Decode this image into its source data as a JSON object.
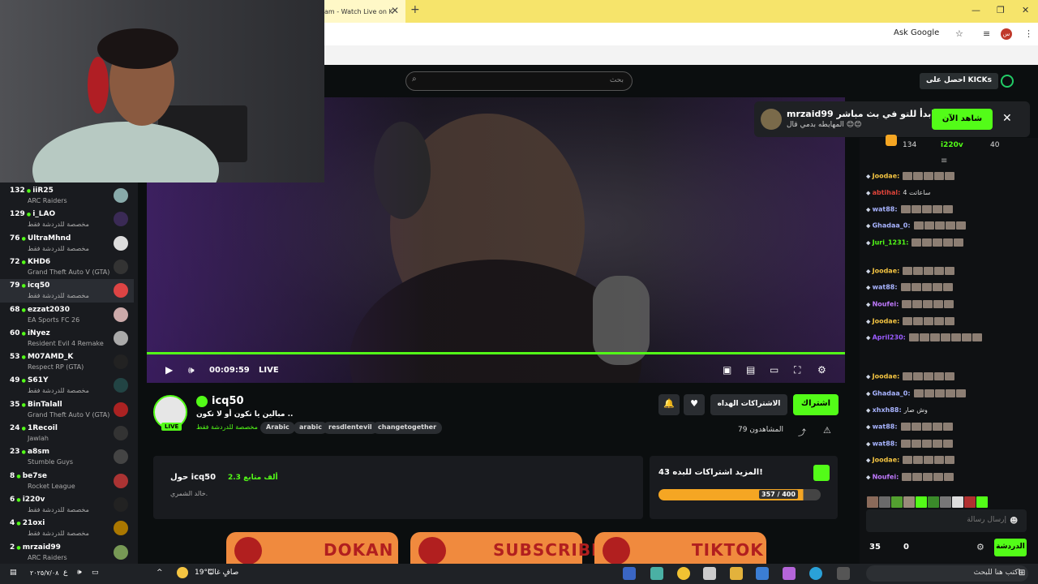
{
  "browser": {
    "tab_title": "am - Watch Live on K",
    "ask_google": "Ask Google",
    "profile_initial": "س"
  },
  "nav": {
    "search_placeholder": "بحث",
    "get_kicks": "احصل على KICKs"
  },
  "notification": {
    "title": "mrzaid99 ابدأ للتو في بث مباشر!",
    "subtitle": "المهايطه بدمي قال 😊😊",
    "watch_now": "شاهد الآن"
  },
  "sidebar": {
    "channels": [
      {
        "count": "132",
        "name": "iiR25",
        "game": "ARC Raiders"
      },
      {
        "count": "129",
        "name": "i_LAO",
        "game": "مخصصة للدردشة فقط"
      },
      {
        "count": "76",
        "name": "UltraMhnd",
        "game": "مخصصة للدردشة فقط"
      },
      {
        "count": "72",
        "name": "KHD6",
        "game": "Grand Theft Auto V (GTA)"
      },
      {
        "count": "79",
        "name": "icq50",
        "game": "مخصصة للدردشة فقط"
      },
      {
        "count": "68",
        "name": "ezzat2030",
        "game": "EA Sports FC 26"
      },
      {
        "count": "60",
        "name": "iNyez",
        "game": "Resident Evil 4 Remake"
      },
      {
        "count": "53",
        "name": "M07AMD_K",
        "game": "Respect RP (GTA)"
      },
      {
        "count": "49",
        "name": "S61Y",
        "game": "مخصصة للدردشة فقط"
      },
      {
        "count": "35",
        "name": "BinTalall",
        "game": "Grand Theft Auto V (GTA)"
      },
      {
        "count": "24",
        "name": "1Recoil",
        "game": "Jawlah"
      },
      {
        "count": "23",
        "name": "a8sm",
        "game": "Stumble Guys"
      },
      {
        "count": "8",
        "name": "be7se",
        "game": "Rocket League"
      },
      {
        "count": "6",
        "name": "i220v",
        "game": "مخصصة للدردشة فقط"
      },
      {
        "count": "4",
        "name": "21oxi",
        "game": "مخصصة للدردشة فقط"
      },
      {
        "count": "2",
        "name": "mrzaid99",
        "game": "ARC Raiders"
      }
    ]
  },
  "player": {
    "time": "00:09:59",
    "live": "LIVE"
  },
  "streamer": {
    "name": "icq50",
    "live_badge": "LIVE",
    "title": "مبالين يا نكون أو لا نكون ..",
    "category": "مخصصة للدردشة فقط",
    "tags": [
      "Arabic",
      "arabic",
      "resdlentevil",
      "changetogether"
    ],
    "follow": "اشتراك",
    "subscriptions": "الاشتراكات الهداه",
    "viewers": "المشاهدون 79"
  },
  "about": {
    "title": "حول icq50",
    "followers": "2.3 ألف متابع",
    "desc": "خالد الشمري."
  },
  "sub_goal": {
    "title": "المزيد اشتراكات للبده 43!",
    "progress_text": "357 / 400",
    "progress": 0.8925
  },
  "banners": [
    "DOKAN",
    "SUBSCRIBE",
    "TIKTOK"
  ],
  "chat": {
    "top_stats": {
      "left": "134",
      "mid": "i220v",
      "right": "40"
    },
    "messages": [
      {
        "name": "Joodae:",
        "color": "#f5c542",
        "text": ""
      },
      {
        "name": "abtihal:",
        "color": "#e0443a",
        "text": "ساعاتت 4"
      },
      {
        "name": "wat88:",
        "color": "#a8b4ff",
        "text": ""
      },
      {
        "name": "Ghadaa_0:",
        "color": "#a8b4ff",
        "text": ""
      },
      {
        "name": "Juri_1231:",
        "color": "#53fc18",
        "text": ""
      },
      {
        "name": "Joodae:",
        "color": "#f5c542",
        "text": ""
      },
      {
        "name": "wat88:",
        "color": "#a8b4ff",
        "text": ""
      },
      {
        "name": "Noufei:",
        "color": "#c17aff",
        "text": ""
      },
      {
        "name": "Joodae:",
        "color": "#f5c542",
        "text": ""
      },
      {
        "name": "April230:",
        "color": "#9b5cff",
        "text": ""
      },
      {
        "name": "Joodae:",
        "color": "#f5c542",
        "text": ""
      },
      {
        "name": "Ghadaa_0:",
        "color": "#a8b4ff",
        "text": ""
      },
      {
        "name": "xhxh88:",
        "color": "#a8b4ff",
        "text": "وش صار"
      },
      {
        "name": "wat88:",
        "color": "#a8b4ff",
        "text": ""
      },
      {
        "name": "wat88:",
        "color": "#a8b4ff",
        "text": ""
      },
      {
        "name": "Joodae:",
        "color": "#f5c542",
        "text": ""
      },
      {
        "name": "Noufei:",
        "color": "#c17aff",
        "text": ""
      }
    ],
    "input_placeholder": "إرسال رسالة",
    "count_left": "35",
    "count_mid": "0",
    "chat_button": "الدردشة"
  },
  "taskbar": {
    "weather": "صافٍ غالبًا",
    "temp": "19°C",
    "search": "اكتب هنا للبحث",
    "clock_lang": "ع",
    "date": "٢٠٢٥/٧/٠٨"
  }
}
